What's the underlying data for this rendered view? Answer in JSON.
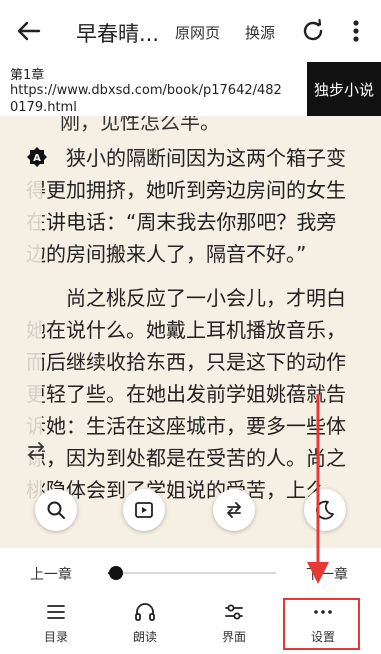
{
  "header": {
    "title": "早春晴...",
    "original_page": "原网页",
    "change_source": "换源"
  },
  "chapter": {
    "name": "第1章",
    "url": "https://www.dbxsd.com/book/p17642/4820179.html",
    "source_badge": "独步小说"
  },
  "reader": {
    "top_line": "刚，见性怎么半。",
    "paragraphs": [
      "　　狭小的隔断间因为这两个箱子变得更加拥挤，她听到旁边房间的女生在讲电话：“周末我去你那吧？我旁边的房间搬来人了，隔音不好。”",
      "　　尚之桃反应了一小会儿，才明白她在说什么。她戴上耳机播放音乐，而后继续收拾东西，只是这下的动作更轻了些。在她出发前学姐姚蓓就告诉她：生活在这座城市，要多一些体谅，因为到处都是在受苦的人。尚之桃隐体会到了学姐说的受苦，上么。"
    ]
  },
  "progress": {
    "prev_label": "上一章",
    "next_label": "下一章",
    "value_fraction": 0.05
  },
  "bottom_nav": [
    {
      "label": "目录",
      "icon": "list-icon"
    },
    {
      "label": "朗读",
      "icon": "headphones-icon"
    },
    {
      "label": "界面",
      "icon": "sliders-icon"
    },
    {
      "label": "设置",
      "icon": "more-horizontal-icon"
    }
  ],
  "colors": {
    "reader_bg": "#f6efe3",
    "highlight": "#e53935",
    "badge_bg": "#111111"
  }
}
